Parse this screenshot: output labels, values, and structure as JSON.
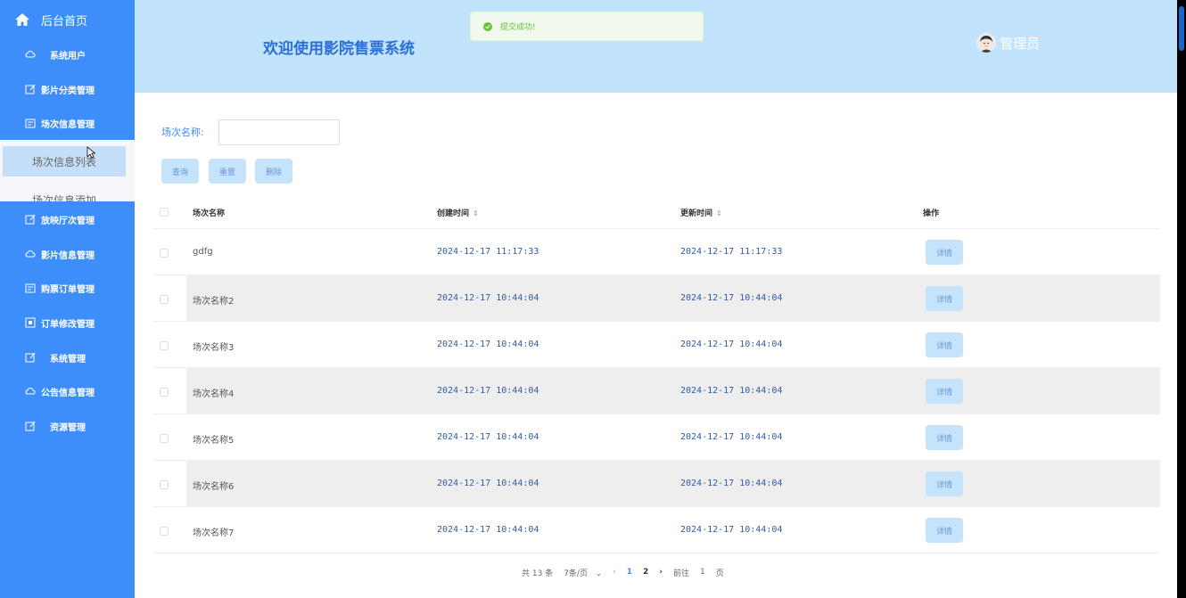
{
  "sidebar": {
    "brand": "后台首页",
    "items": [
      {
        "label": "系统用户",
        "icon": "cloud-icon"
      },
      {
        "label": "影片分类管理",
        "icon": "edit-icon"
      },
      {
        "label": "场次信息管理",
        "icon": "doc-icon"
      },
      {
        "label": "放映厅次管理",
        "icon": "edit-icon"
      },
      {
        "label": "影片信息管理",
        "icon": "cloud-icon"
      },
      {
        "label": "购票订单管理",
        "icon": "doc-icon"
      },
      {
        "label": "订单修改管理",
        "icon": "square-icon"
      },
      {
        "label": "系统管理",
        "icon": "edit-icon"
      },
      {
        "label": "公告信息管理",
        "icon": "cloud-icon"
      },
      {
        "label": "资源管理",
        "icon": "edit-icon"
      }
    ],
    "submenu": [
      "场次信息列表",
      "场次信息添加"
    ]
  },
  "header": {
    "title": "欢迎使用影院售票系统",
    "toast": "提交成功!",
    "user": "管理员"
  },
  "search": {
    "label": "场次名称:",
    "value": "",
    "buttons": [
      "查询",
      "重置",
      "删除"
    ]
  },
  "table": {
    "columns": [
      "场次名称",
      "创建时间",
      "更新时间",
      "操作"
    ],
    "rows": [
      {
        "name": "gdfg",
        "created": "2024-12-17 11:17:33",
        "updated": "2024-12-17 11:17:33",
        "action": "详情"
      },
      {
        "name": "场次名称2",
        "created": "2024-12-17 10:44:04",
        "updated": "2024-12-17 10:44:04",
        "action": "详情"
      },
      {
        "name": "场次名称3",
        "created": "2024-12-17 10:44:04",
        "updated": "2024-12-17 10:44:04",
        "action": "详情"
      },
      {
        "name": "场次名称4",
        "created": "2024-12-17 10:44:04",
        "updated": "2024-12-17 10:44:04",
        "action": "详情"
      },
      {
        "name": "场次名称5",
        "created": "2024-12-17 10:44:04",
        "updated": "2024-12-17 10:44:04",
        "action": "详情"
      },
      {
        "name": "场次名称6",
        "created": "2024-12-17 10:44:04",
        "updated": "2024-12-17 10:44:04",
        "action": "详情"
      },
      {
        "name": "场次名称7",
        "created": "2024-12-17 10:44:04",
        "updated": "2024-12-17 10:44:04",
        "action": "详情"
      }
    ]
  },
  "pager": {
    "total": "共 13 条",
    "page_size": "7条/页",
    "pages": [
      "1",
      "2"
    ],
    "current_page": 1,
    "goto_prefix": "前往",
    "goto_value": "1",
    "goto_suffix": "页"
  },
  "colors": {
    "sidebar": "#3d8efb",
    "header": "#c1e3fc",
    "accent": "#3d8efb",
    "success": "#67c23a"
  }
}
